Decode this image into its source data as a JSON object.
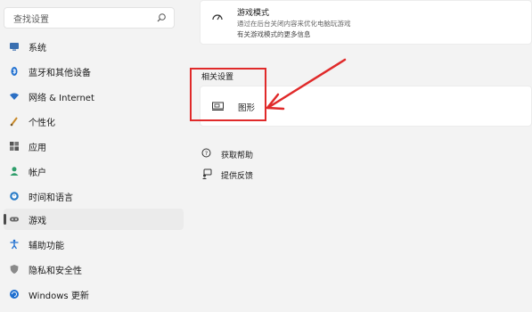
{
  "sidebar": {
    "search_placeholder": "查找设置",
    "items": [
      {
        "label": "系统",
        "icon": "monitor-icon"
      },
      {
        "label": "蓝牙和其他设备",
        "icon": "bluetooth-icon"
      },
      {
        "label": "网络 & Internet",
        "icon": "wifi-icon"
      },
      {
        "label": "个性化",
        "icon": "brush-icon"
      },
      {
        "label": "应用",
        "icon": "apps-icon"
      },
      {
        "label": "帐户",
        "icon": "person-icon"
      },
      {
        "label": "时间和语言",
        "icon": "globe-clock-icon"
      },
      {
        "label": "游戏",
        "icon": "controller-icon",
        "selected": true
      },
      {
        "label": "辅助功能",
        "icon": "accessibility-icon"
      },
      {
        "label": "隐私和安全性",
        "icon": "shield-icon"
      },
      {
        "label": "Windows 更新",
        "icon": "update-icon"
      }
    ]
  },
  "main": {
    "game_mode": {
      "title": "游戏模式",
      "description": "通过在后台关闭内容来优化电脑玩游戏",
      "more": "有关游戏模式的更多信息"
    },
    "related_settings": {
      "label": "相关设置",
      "graphics": "图形"
    },
    "links": {
      "help": "获取帮助",
      "feedback": "提供反馈"
    }
  },
  "colors": {
    "highlight_red": "#e02a2a",
    "accent_blue": "#0067c0"
  }
}
